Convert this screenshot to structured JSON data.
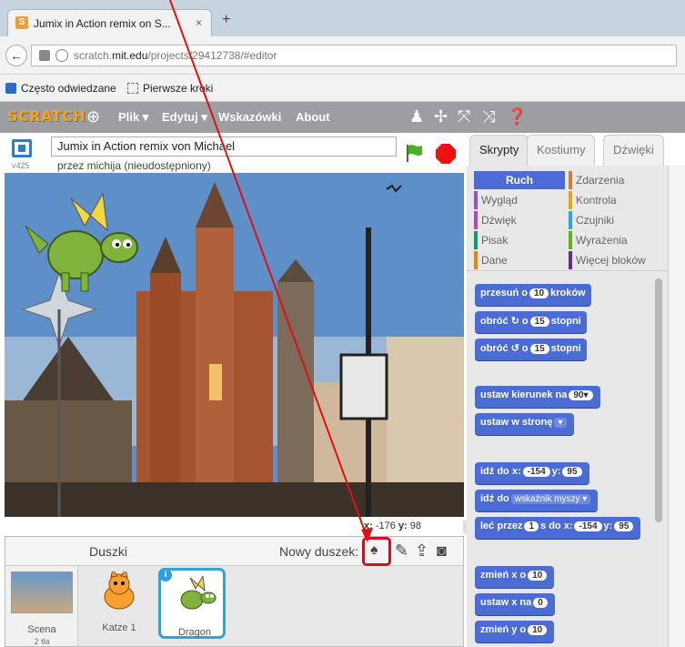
{
  "browser": {
    "tab_title": "Jumix in Action remix on S...",
    "tab_close": "×",
    "new_tab": "+",
    "url_plain": "scratch.",
    "url_domain": "mit.edu",
    "url_path": "/projects/29412738/#editor",
    "bookmarks": [
      "Często odwiedzane",
      "Pierwsze kroki"
    ]
  },
  "scratch_menu": {
    "logo": "SCRATCH",
    "items": [
      "Plik ▾",
      "Edytuj ▾",
      "Wskazówki",
      "About"
    ]
  },
  "project": {
    "version": "v425",
    "title": "Jumix in Action remix von Michael",
    "byline": "przez michija (nieudostępniony)"
  },
  "stage": {
    "x_label": "x:",
    "x_value": "-176",
    "y_label": "y:",
    "y_value": "98"
  },
  "sprites": {
    "header": "Duszki",
    "new_sprite_label": "Nowy duszek:",
    "scene_label": "Scena",
    "scene_count": "2 tła",
    "items": [
      "Katze 1",
      "Dragon"
    ]
  },
  "tabs": [
    "Skrypty",
    "Kostiumy",
    "Dźwięki"
  ],
  "categories": [
    {
      "label": "Ruch",
      "color": "#4a6cd4"
    },
    {
      "label": "Zdarzenia",
      "color": "#c88330"
    },
    {
      "label": "Wygląd",
      "color": "#8a55d7"
    },
    {
      "label": "Kontrola",
      "color": "#e1a91a"
    },
    {
      "label": "Dźwięk",
      "color": "#bb42c3"
    },
    {
      "label": "Czujniki",
      "color": "#2ca5e2"
    },
    {
      "label": "Pisak",
      "color": "#0e9a6c"
    },
    {
      "label": "Wyrażenia",
      "color": "#5cb712"
    },
    {
      "label": "Dane",
      "color": "#ee7d16"
    },
    {
      "label": "Więcej bloków",
      "color": "#632d99"
    }
  ],
  "blocks": {
    "move": {
      "pre": "przesuń o",
      "val": "10",
      "post": "kroków"
    },
    "turn_right": {
      "pre": "obróć ↻ o",
      "val": "15",
      "post": "stopni"
    },
    "turn_left": {
      "pre": "obróć ↺ o",
      "val": "15",
      "post": "stopni"
    },
    "point_dir": {
      "pre": "ustaw kierunek na",
      "val": "90▾"
    },
    "point_towards": {
      "pre": "ustaw w stronę",
      "val": "▾"
    },
    "goto_xy": {
      "pre": "idź do x:",
      "x": "-154",
      "mid": "y:",
      "y": "95"
    },
    "goto": {
      "pre": "idź do",
      "val": "wskaźnik myszy ▾"
    },
    "glide": {
      "pre": "leć przez",
      "secs": "1",
      "mid": "s do x:",
      "x": "-154",
      "mid2": "y:",
      "y": "95"
    },
    "change_x": {
      "pre": "zmień x o",
      "val": "10"
    },
    "set_x": {
      "pre": "ustaw x na",
      "val": "0"
    },
    "change_y": {
      "pre": "zmień y o",
      "val": "10"
    }
  }
}
